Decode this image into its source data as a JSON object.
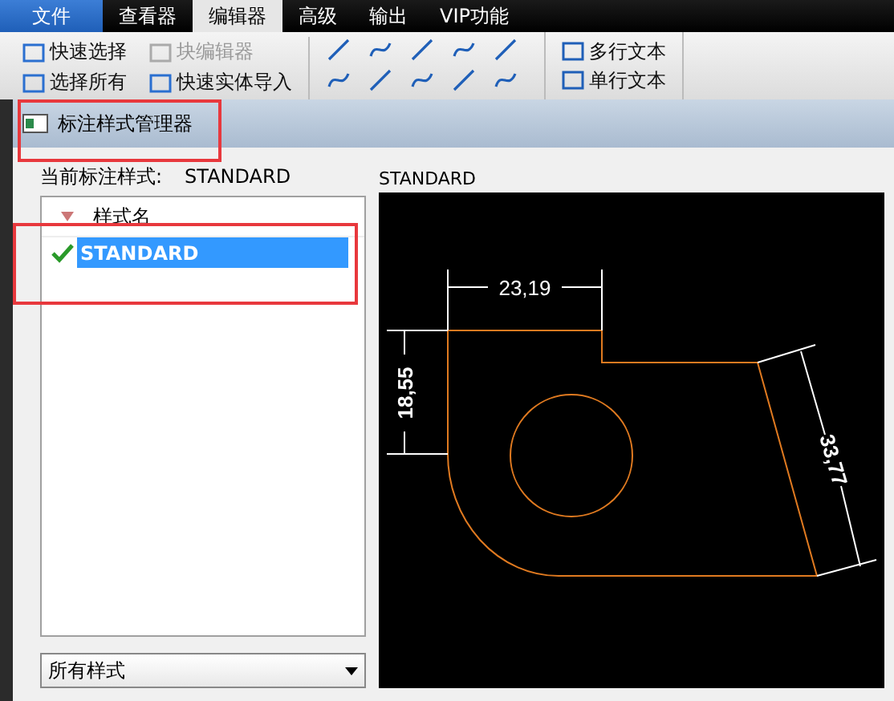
{
  "menu_tabs": [
    {
      "label": "文件",
      "kind": "file",
      "selected": false
    },
    {
      "label": "查看器",
      "kind": "tab",
      "selected": false
    },
    {
      "label": "编辑器",
      "kind": "tab",
      "selected": true
    },
    {
      "label": "高级",
      "kind": "tab",
      "selected": false
    },
    {
      "label": "输出",
      "kind": "tab",
      "selected": false
    },
    {
      "label": "VIP功能",
      "kind": "tab",
      "selected": false
    }
  ],
  "ribbon": {
    "select_tools": [
      {
        "label": "快速选择",
        "disabled": false
      },
      {
        "label": "块编辑器",
        "disabled": true
      },
      {
        "label": "选择所有",
        "disabled": false
      },
      {
        "label": "快速实体导入",
        "disabled": false
      }
    ],
    "text_tools": [
      {
        "label": "多行文本",
        "disabled": false
      },
      {
        "label": "单行文本",
        "disabled": false
      }
    ]
  },
  "dialog": {
    "title": "标注样式管理器",
    "current_style_label": "当前标注样式:",
    "current_style": "STANDARD",
    "list_header": "样式名",
    "styles": [
      {
        "name": "STANDARD",
        "selected": true,
        "current": true
      }
    ],
    "filter": "所有样式",
    "preview_title": "STANDARD",
    "preview_dimensions": [
      {
        "kind": "horizontal",
        "text": "23,19"
      },
      {
        "kind": "vertical",
        "text": "18,55"
      },
      {
        "kind": "aligned",
        "text": "33,77"
      }
    ]
  }
}
